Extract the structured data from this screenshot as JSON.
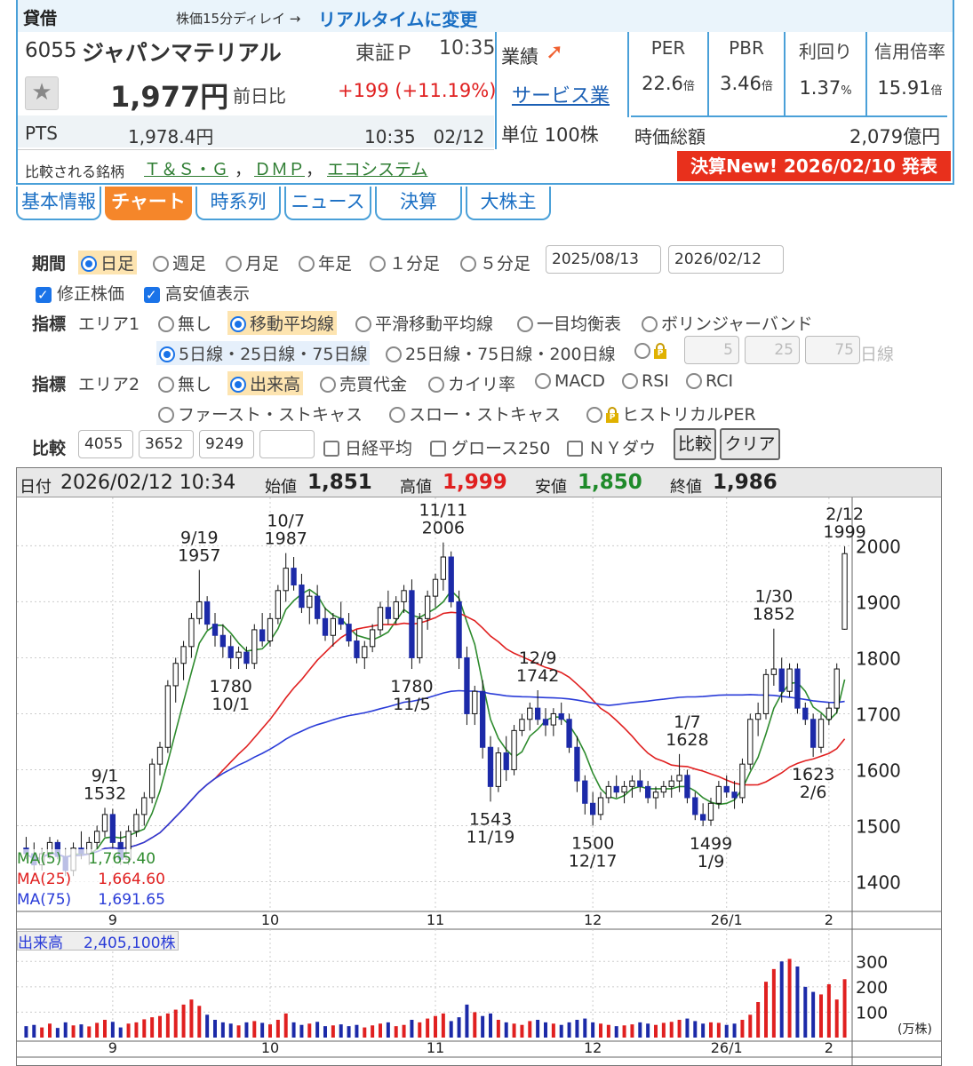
{
  "header": {
    "loan_label": "貸借",
    "delay_note": "株価15分ディレイ →",
    "realtime_link": "リアルタイムに変更",
    "code": "6055",
    "name": "ジャパンマテリアル",
    "market": "東証Ｐ",
    "time": "10:35",
    "gyoseki_label": "業績",
    "sector": "サービス業",
    "price": "1,977円",
    "change_label": "前日比",
    "change": "+199 (+11.19%)",
    "pts_label": "PTS",
    "pts_price": "1,978.4円",
    "pts_time": "10:35　02/12",
    "unit": "単位 100株",
    "compare_label": "比較される銘柄",
    "compare_items": [
      "Ｔ＆Ｓ・Ｇ",
      "ＤＭＰ",
      "エコシステム"
    ],
    "compare_sep": "，",
    "kessan": "決算New!  2026/02/10 発表"
  },
  "metrics": {
    "labels": [
      "PER",
      "PBR",
      "利回り",
      "信用倍率"
    ],
    "values": [
      "22.6",
      "3.46",
      "1.37",
      "15.91"
    ],
    "units": [
      "倍",
      "倍",
      "%",
      "倍"
    ],
    "market_cap_label": "時価総額",
    "market_cap": "2,079億円"
  },
  "tabs": [
    "基本情報",
    "チャート",
    "時系列",
    "ニュース",
    "決算",
    "大株主"
  ],
  "controls": {
    "period_label": "期間",
    "periods": [
      "日足",
      "週足",
      "月足",
      "年足",
      "１分足",
      "５分足"
    ],
    "date_from": "2025/08/13",
    "date_to": "2026/02/12",
    "adjusted": "修正株価",
    "highlow": "高安値表示",
    "ind_label": "指標",
    "area1": "エリア1",
    "area1_opts": [
      "無し",
      "移動平均線",
      "平滑移動平均線",
      "一目均衡表",
      "ボリンジャーバンド"
    ],
    "ma_opts": [
      "5日線・25日線・75日線",
      "25日線・75日線・200日線"
    ],
    "ma_inputs": [
      "5",
      "25",
      "75"
    ],
    "ma_suffix": "日線",
    "area2": "エリア2",
    "area2_opts": [
      "無し",
      "出来高",
      "売買代金",
      "カイリ率",
      "MACD",
      "RSI",
      "RCI"
    ],
    "area2_opts2": [
      "ファースト・ストキャス",
      "スロー・ストキャス",
      "ヒストリカルPER"
    ],
    "cmp_label": "比較",
    "cmp_codes": [
      "4055",
      "3652",
      "9249",
      ""
    ],
    "cmp_indices": [
      "日経平均",
      "グロース250",
      "ＮＹダウ"
    ],
    "btn_compare": "比較",
    "btn_clear": "クリア"
  },
  "chart_info": {
    "date_label": "日付",
    "date": "2026/02/12 10:34",
    "open_label": "始値",
    "open": "1,851",
    "high_label": "高値",
    "high": "1,999",
    "low_label": "安値",
    "low": "1,850",
    "close_label": "終値",
    "close": "1,986"
  },
  "chart_data": {
    "type": "candlestick",
    "ylim": [
      1350,
      2080
    ],
    "yticks": [
      1400,
      1500,
      1600,
      1700,
      1800,
      1900,
      2000
    ],
    "month_labels": [
      {
        "label": "9",
        "i": 11
      },
      {
        "label": "10",
        "i": 31
      },
      {
        "label": "11",
        "i": 52
      },
      {
        "label": "12",
        "i": 72
      },
      {
        "label": "26/1",
        "i": 89
      },
      {
        "label": "2",
        "i": 102
      }
    ],
    "ohlc": [
      [
        1460,
        1480,
        1440,
        1450
      ],
      [
        1450,
        1470,
        1420,
        1430
      ],
      [
        1430,
        1460,
        1420,
        1450
      ],
      [
        1450,
        1480,
        1440,
        1470
      ],
      [
        1470,
        1475,
        1440,
        1445
      ],
      [
        1445,
        1460,
        1410,
        1420
      ],
      [
        1420,
        1470,
        1410,
        1460
      ],
      [
        1460,
        1490,
        1440,
        1450
      ],
      [
        1450,
        1480,
        1430,
        1470
      ],
      [
        1470,
        1500,
        1460,
        1490
      ],
      [
        1490,
        1532,
        1480,
        1520
      ],
      [
        1520,
        1530,
        1460,
        1470
      ],
      [
        1470,
        1490,
        1430,
        1440
      ],
      [
        1440,
        1500,
        1430,
        1490
      ],
      [
        1490,
        1530,
        1480,
        1520
      ],
      [
        1520,
        1560,
        1500,
        1550
      ],
      [
        1550,
        1620,
        1540,
        1610
      ],
      [
        1610,
        1650,
        1590,
        1640
      ],
      [
        1640,
        1760,
        1630,
        1750
      ],
      [
        1750,
        1800,
        1720,
        1790
      ],
      [
        1790,
        1830,
        1760,
        1820
      ],
      [
        1820,
        1880,
        1800,
        1870
      ],
      [
        1870,
        1957,
        1860,
        1900
      ],
      [
        1900,
        1910,
        1850,
        1860
      ],
      [
        1860,
        1880,
        1820,
        1840
      ],
      [
        1840,
        1860,
        1800,
        1820
      ],
      [
        1820,
        1840,
        1780,
        1800
      ],
      [
        1800,
        1820,
        1780,
        1810
      ],
      [
        1810,
        1820,
        1780,
        1790
      ],
      [
        1790,
        1860,
        1780,
        1850
      ],
      [
        1850,
        1880,
        1820,
        1830
      ],
      [
        1830,
        1880,
        1820,
        1870
      ],
      [
        1870,
        1930,
        1860,
        1920
      ],
      [
        1920,
        1987,
        1900,
        1960
      ],
      [
        1960,
        1980,
        1920,
        1930
      ],
      [
        1930,
        1950,
        1880,
        1890
      ],
      [
        1890,
        1920,
        1860,
        1910
      ],
      [
        1910,
        1930,
        1860,
        1870
      ],
      [
        1870,
        1890,
        1830,
        1840
      ],
      [
        1840,
        1880,
        1820,
        1870
      ],
      [
        1870,
        1900,
        1850,
        1860
      ],
      [
        1860,
        1880,
        1820,
        1830
      ],
      [
        1830,
        1850,
        1790,
        1800
      ],
      [
        1800,
        1830,
        1780,
        1820
      ],
      [
        1820,
        1860,
        1810,
        1850
      ],
      [
        1850,
        1900,
        1840,
        1890
      ],
      [
        1890,
        1920,
        1860,
        1870
      ],
      [
        1870,
        1910,
        1860,
        1900
      ],
      [
        1900,
        1930,
        1880,
        1920
      ],
      [
        1920,
        1940,
        1780,
        1800
      ],
      [
        1800,
        1880,
        1790,
        1870
      ],
      [
        1870,
        1920,
        1850,
        1910
      ],
      [
        1910,
        1950,
        1890,
        1940
      ],
      [
        1940,
        2006,
        1920,
        1980
      ],
      [
        1980,
        1990,
        1890,
        1900
      ],
      [
        1900,
        1920,
        1780,
        1800
      ],
      [
        1800,
        1820,
        1680,
        1700
      ],
      [
        1700,
        1750,
        1680,
        1740
      ],
      [
        1740,
        1760,
        1620,
        1640
      ],
      [
        1640,
        1660,
        1543,
        1570
      ],
      [
        1570,
        1640,
        1560,
        1630
      ],
      [
        1630,
        1660,
        1580,
        1600
      ],
      [
        1600,
        1680,
        1590,
        1670
      ],
      [
        1670,
        1700,
        1660,
        1690
      ],
      [
        1690,
        1720,
        1670,
        1710
      ],
      [
        1710,
        1742,
        1680,
        1690
      ],
      [
        1690,
        1710,
        1660,
        1680
      ],
      [
        1680,
        1710,
        1660,
        1700
      ],
      [
        1700,
        1720,
        1680,
        1690
      ],
      [
        1690,
        1700,
        1630,
        1640
      ],
      [
        1640,
        1660,
        1560,
        1580
      ],
      [
        1580,
        1590,
        1520,
        1540
      ],
      [
        1540,
        1560,
        1500,
        1520
      ],
      [
        1520,
        1560,
        1510,
        1550
      ],
      [
        1550,
        1580,
        1540,
        1570
      ],
      [
        1570,
        1590,
        1550,
        1560
      ],
      [
        1560,
        1580,
        1540,
        1570
      ],
      [
        1570,
        1590,
        1550,
        1580
      ],
      [
        1580,
        1600,
        1560,
        1570
      ],
      [
        1570,
        1580,
        1540,
        1550
      ],
      [
        1550,
        1570,
        1530,
        1560
      ],
      [
        1560,
        1580,
        1550,
        1570
      ],
      [
        1570,
        1590,
        1550,
        1580
      ],
      [
        1580,
        1628,
        1560,
        1590
      ],
      [
        1590,
        1600,
        1540,
        1550
      ],
      [
        1550,
        1560,
        1510,
        1520
      ],
      [
        1520,
        1540,
        1499,
        1510
      ],
      [
        1510,
        1550,
        1500,
        1540
      ],
      [
        1540,
        1580,
        1530,
        1570
      ],
      [
        1570,
        1590,
        1550,
        1560
      ],
      [
        1560,
        1580,
        1530,
        1550
      ],
      [
        1550,
        1620,
        1540,
        1610
      ],
      [
        1610,
        1700,
        1600,
        1690
      ],
      [
        1690,
        1720,
        1660,
        1700
      ],
      [
        1700,
        1780,
        1690,
        1770
      ],
      [
        1770,
        1852,
        1750,
        1780
      ],
      [
        1780,
        1800,
        1720,
        1740
      ],
      [
        1740,
        1790,
        1730,
        1780
      ],
      [
        1780,
        1790,
        1700,
        1710
      ],
      [
        1710,
        1720,
        1680,
        1690
      ],
      [
        1690,
        1700,
        1623,
        1640
      ],
      [
        1640,
        1700,
        1630,
        1690
      ],
      [
        1690,
        1720,
        1680,
        1710
      ],
      [
        1710,
        1790,
        1700,
        1780
      ],
      [
        1851,
        1999,
        1850,
        1986
      ]
    ],
    "ma_legend": [
      {
        "name": "MA(5)",
        "value": "1,765.40",
        "color": "#2e8b2e"
      },
      {
        "name": "MA(25)",
        "value": "1,664.60",
        "color": "#e02020"
      },
      {
        "name": "MA(75)",
        "value": "1,691.65",
        "color": "#2a3cd8"
      }
    ],
    "annotations": [
      {
        "i": 10,
        "value": 1532,
        "date": "9/1",
        "pos": "above"
      },
      {
        "i": 22,
        "value": 1957,
        "date": "9/19",
        "pos": "above"
      },
      {
        "i": 26,
        "value": 1780,
        "date": "10/1",
        "pos": "below"
      },
      {
        "i": 33,
        "value": 1987,
        "date": "10/7",
        "pos": "above"
      },
      {
        "i": 49,
        "value": 1780,
        "date": "11/5",
        "pos": "below"
      },
      {
        "i": 53,
        "value": 2006,
        "date": "11/11",
        "pos": "above"
      },
      {
        "i": 59,
        "value": 1543,
        "date": "11/19",
        "pos": "below"
      },
      {
        "i": 65,
        "value": 1742,
        "date": "12/9",
        "pos": "above"
      },
      {
        "i": 72,
        "value": 1500,
        "date": "12/17",
        "pos": "below"
      },
      {
        "i": 84,
        "value": 1628,
        "date": "1/7",
        "pos": "above"
      },
      {
        "i": 87,
        "value": 1499,
        "date": "1/9",
        "pos": "below"
      },
      {
        "i": 95,
        "value": 1852,
        "date": "1/30",
        "pos": "above"
      },
      {
        "i": 100,
        "value": 1623,
        "date": "2/6",
        "pos": "below"
      },
      {
        "i": 104,
        "value": 1999,
        "date": "2/12",
        "pos": "above"
      }
    ],
    "volume_label": "出来高",
    "volume_value": "2,405,100株",
    "volume_unit": "(万株)",
    "volume_ylim": [
      0,
      350
    ],
    "volume_ticks": [
      100,
      200,
      300
    ],
    "volume": [
      45,
      50,
      40,
      55,
      38,
      60,
      48,
      52,
      44,
      58,
      70,
      62,
      40,
      55,
      60,
      72,
      80,
      85,
      95,
      110,
      130,
      150,
      125,
      90,
      70,
      60,
      55,
      48,
      60,
      65,
      58,
      52,
      70,
      95,
      60,
      50,
      55,
      62,
      45,
      48,
      52,
      45,
      50,
      40,
      48,
      55,
      60,
      45,
      50,
      70,
      60,
      75,
      85,
      95,
      65,
      80,
      130,
      100,
      85,
      95,
      70,
      60,
      55,
      50,
      65,
      70,
      60,
      55,
      50,
      60,
      70,
      75,
      60,
      55,
      50,
      45,
      48,
      52,
      60,
      55,
      50,
      58,
      62,
      70,
      75,
      65,
      55,
      60,
      58,
      50,
      55,
      70,
      90,
      140,
      220,
      270,
      300,
      310,
      280,
      200,
      180,
      170,
      210,
      150,
      230
    ]
  }
}
